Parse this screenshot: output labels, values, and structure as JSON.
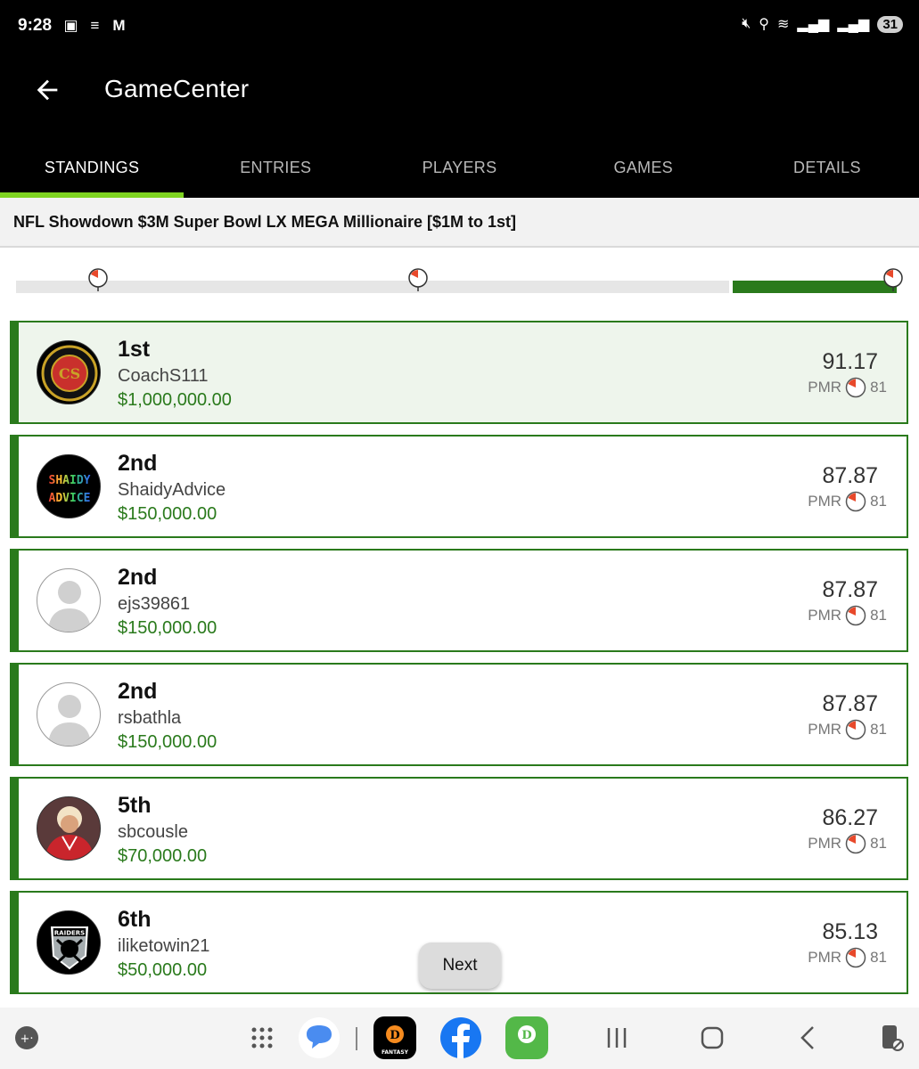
{
  "status_bar": {
    "time": "9:28",
    "battery": "31"
  },
  "app_bar": {
    "title": "GameCenter"
  },
  "tabs": [
    {
      "label": "STANDINGS",
      "active": true
    },
    {
      "label": "ENTRIES",
      "active": false
    },
    {
      "label": "PLAYERS",
      "active": false
    },
    {
      "label": "GAMES",
      "active": false
    },
    {
      "label": "DETAILS",
      "active": false
    }
  ],
  "contest": {
    "title": "NFL Showdown $3M Super Bowl LX MEGA Millionaire [$1M to 1st]"
  },
  "standings": [
    {
      "rank": "1st",
      "username": "CoachS111",
      "prize": "$1,000,000.00",
      "score": "91.17",
      "pmr_label": "PMR",
      "pmr_value": "81",
      "avatar": "coach-logo"
    },
    {
      "rank": "2nd",
      "username": "ShaidyAdvice",
      "prize": "$150,000.00",
      "score": "87.87",
      "pmr_label": "PMR",
      "pmr_value": "81",
      "avatar": "shaidy-logo"
    },
    {
      "rank": "2nd",
      "username": "ejs39861",
      "prize": "$150,000.00",
      "score": "87.87",
      "pmr_label": "PMR",
      "pmr_value": "81",
      "avatar": "default"
    },
    {
      "rank": "2nd",
      "username": "rsbathla",
      "prize": "$150,000.00",
      "score": "87.87",
      "pmr_label": "PMR",
      "pmr_value": "81",
      "avatar": "default"
    },
    {
      "rank": "5th",
      "username": "sbcousle",
      "prize": "$70,000.00",
      "score": "86.27",
      "pmr_label": "PMR",
      "pmr_value": "81",
      "avatar": "photo"
    },
    {
      "rank": "6th",
      "username": "iliketowin21",
      "prize": "$50,000.00",
      "score": "85.13",
      "pmr_label": "PMR",
      "pmr_value": "81",
      "avatar": "raiders-logo"
    }
  ],
  "next_button": {
    "label": "Next"
  },
  "shield_texts": {
    "coach": "CS",
    "shaidy_1": "SHAIDY",
    "shaidy_2": "ADVICE",
    "raiders": "RAIDERS",
    "fantasy": "FANTASY"
  },
  "colors": {
    "accent_green": "#2a7a1c",
    "tab_indicator": "#7ed321",
    "header_bg": "#000000"
  }
}
